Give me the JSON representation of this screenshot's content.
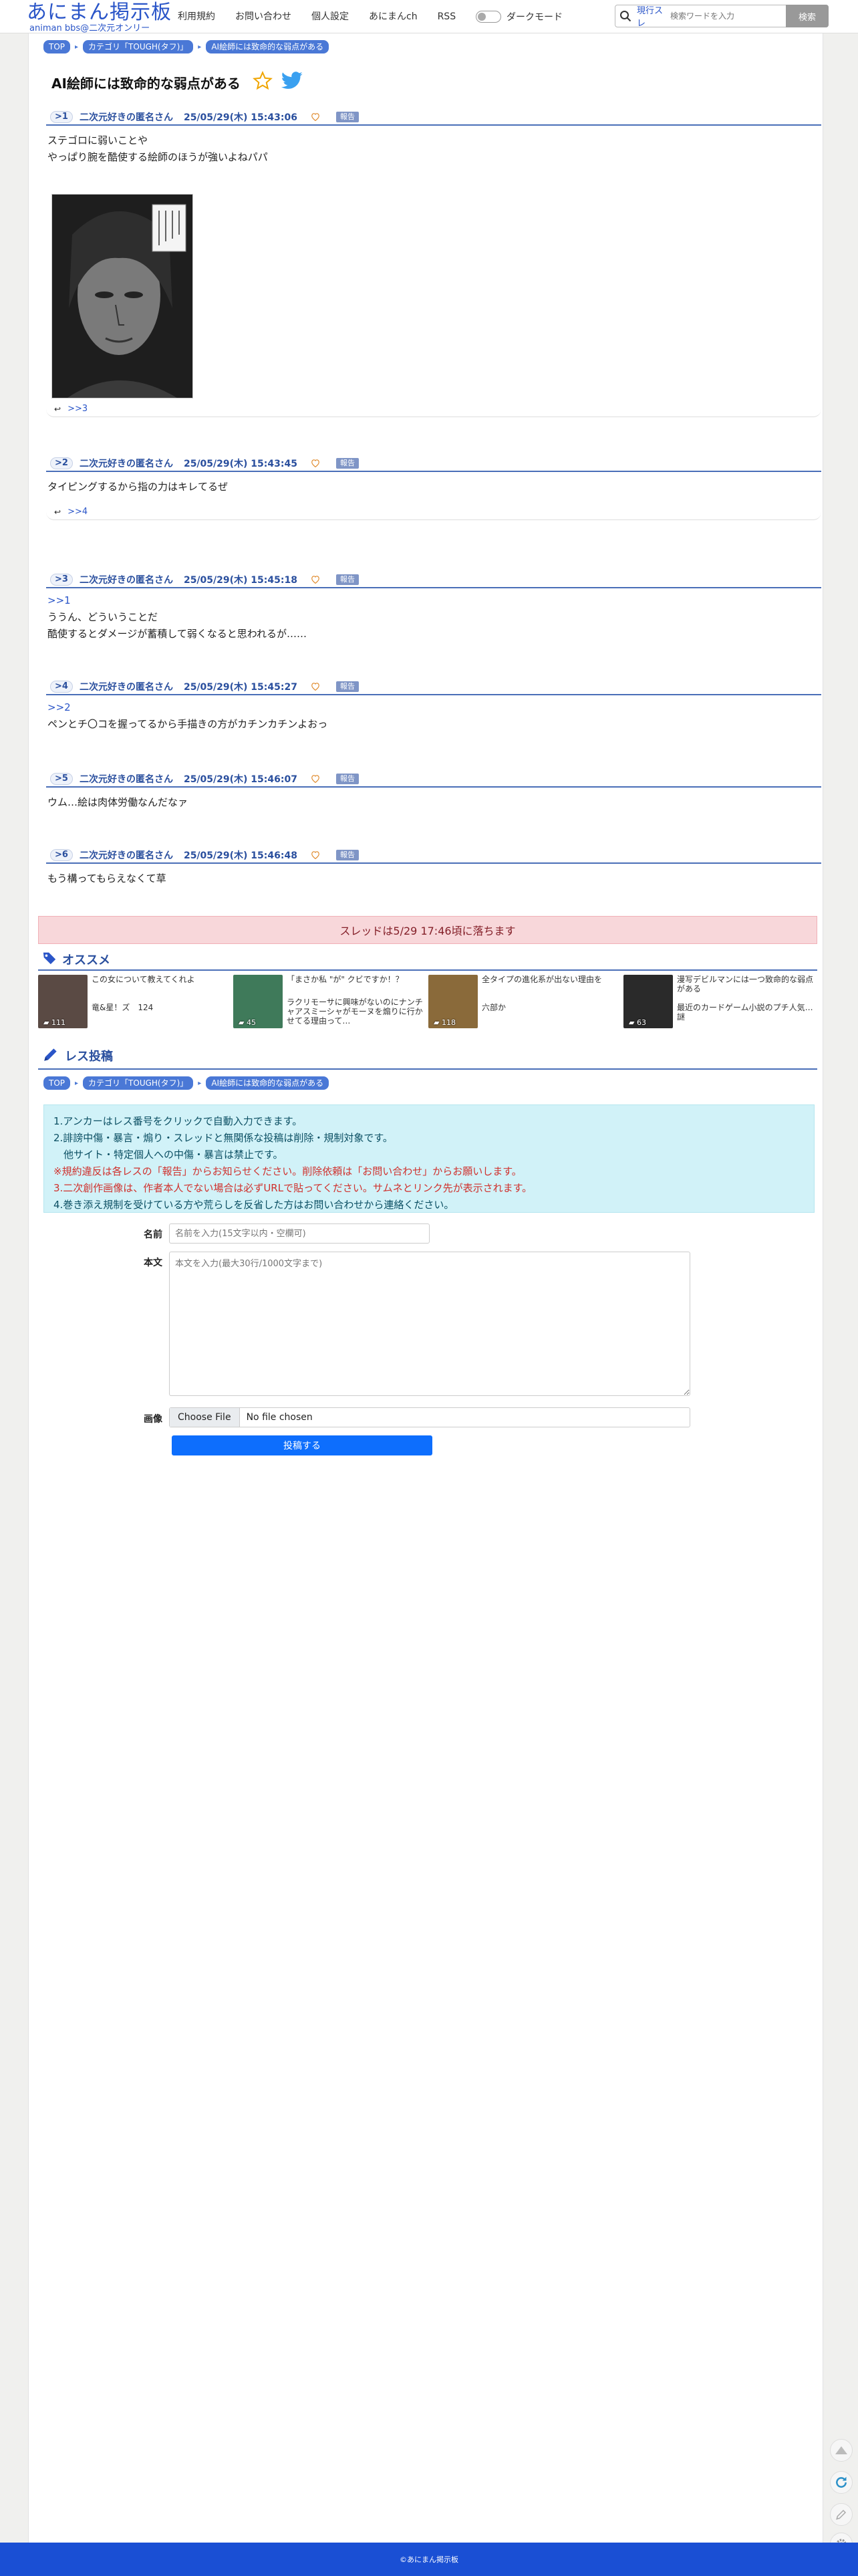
{
  "header": {
    "logo_main": "あにまん掲示板",
    "logo_sub": "animan bbs@二次元オンリー",
    "nav": [
      "利用規約",
      "お問い合わせ",
      "個人設定",
      "あにまんch",
      "RSS"
    ],
    "dark_mode_label": "ダークモード",
    "search_scope": "現行スレ",
    "search_placeholder": "検索ワードを入力",
    "search_button": "検索"
  },
  "breadcrumb": [
    "TOP",
    "カテゴリ「TOUGH(タフ)」",
    "AI絵師には致命的な弱点がある"
  ],
  "thread": {
    "title": "AI絵師には致命的な弱点がある",
    "report_label": "報告",
    "posts": [
      {
        "num": "1",
        "name": "二次元好きの匿名さん",
        "date": "25/05/29(木) 15:43:06",
        "lines": [
          "ステゴロに弱いことや",
          "やっぱり腕を酷使する絵師のほうが強いよねパパ"
        ],
        "replies": ">>3"
      },
      {
        "num": "2",
        "name": "二次元好きの匿名さん",
        "date": "25/05/29(木) 15:43:45",
        "lines": [
          "タイピングするから指の力はキレてるぜ"
        ],
        "replies": ">>4"
      },
      {
        "num": "3",
        "name": "二次元好きの匿名さん",
        "date": "25/05/29(木) 15:45:18",
        "anchor": ">>1",
        "lines": [
          "ううん、どういうことだ",
          "酷使するとダメージが蓄積して弱くなると思われるが……"
        ]
      },
      {
        "num": "4",
        "name": "二次元好きの匿名さん",
        "date": "25/05/29(木) 15:45:27",
        "anchor": ">>2",
        "lines": [
          "ペンとチ〇コを握ってるから手描きの方がカチンカチンよおっ"
        ]
      },
      {
        "num": "5",
        "name": "二次元好きの匿名さん",
        "date": "25/05/29(木) 15:46:07",
        "lines": [
          "ウム…絵は肉体労働なんだなァ"
        ]
      },
      {
        "num": "6",
        "name": "二次元好きの匿名さん",
        "date": "25/05/29(木) 15:46:48",
        "lines": [
          "もう構ってもらえなくて草"
        ]
      }
    ],
    "closed_notice": "スレッドは5/29 17:46頃に落ちます"
  },
  "recommend": {
    "heading": "オススメ",
    "items": [
      {
        "title": "この女について教えてくれよ",
        "title2": "竜&星！ズ　124",
        "count": "111",
        "thumb_color": "#5a4a44"
      },
      {
        "title": "「まさか私 \"が\" クビですか！？",
        "title2": "ラクリモーサに興味がないのにナンチャアスミーシャがモーヌを煽りに行かせてる理由って…",
        "count": "45",
        "thumb_color": "#3f7a5a"
      },
      {
        "title": "全タイプの進化系が出ない理由を",
        "title2": "六部か",
        "count": "118",
        "thumb_color": "#8a6a3a"
      },
      {
        "title": "漫写デビルマンには一つ致命的な弱点がある",
        "title2": "最近のカードゲーム小説のプチ人気…謎",
        "count": "63",
        "thumb_color": "#2a2a2a"
      }
    ]
  },
  "reply_form": {
    "heading": "レス投稿",
    "rules": [
      "1.アンカーはレス番号をクリックで自動入力できます。",
      "2.誹謗中傷・暴言・煽り・スレッドと無関係な投稿は削除・規制対象です。",
      "　他サイト・特定個人への中傷・暴言は禁止です。",
      "※規約違反は各レスの「報告」からお知らせください。削除依頼は「お問い合わせ」からお願いします。",
      "3.二次創作画像は、作者本人でない場合は必ずURLで貼ってください。サムネとリンク先が表示されます。",
      "4.巻き添え規制を受けている方や荒らしを反省した方はお問い合わせから連絡ください。"
    ],
    "name_label": "名前",
    "name_placeholder": "名前を入力(15文字以内・空欄可)",
    "body_label": "本文",
    "body_placeholder": "本文を入力(最大30行/1000文字まで)",
    "image_label": "画像",
    "file_button": "Choose File",
    "file_status": "No file chosen",
    "submit": "投稿する"
  },
  "footer": {
    "copyright": "©あにまん掲示板"
  },
  "colors": {
    "brand": "#2a55c8",
    "accent": "#4a6fb8",
    "footer": "#1a4fd4"
  }
}
